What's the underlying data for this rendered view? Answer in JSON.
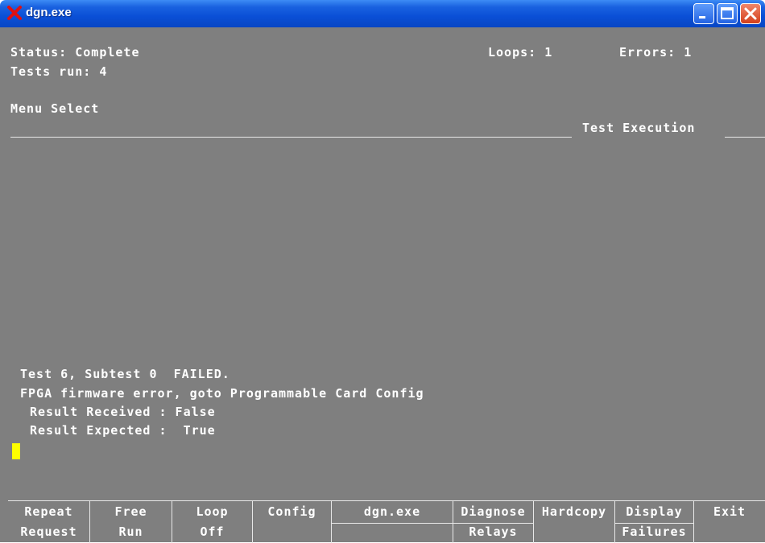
{
  "window": {
    "title": "dgn.exe",
    "icon": "red-x-icon",
    "controls": [
      "minimize-icon",
      "maximize-icon",
      "close-icon"
    ]
  },
  "header": {
    "status": "Status: Complete",
    "loops": "Loops: 1",
    "errors": "Errors: 1",
    "tests_run": "Tests run: 4",
    "menu_title": "Menu Select",
    "section_title": "Test Execution"
  },
  "output": {
    "line1": "Test 6, Subtest 0  FAILED.",
    "line2": "FPGA firmware error, goto Programmable Card Config",
    "line3": "Result Received : False",
    "line4": "Result Expected :  True"
  },
  "function_keys": [
    {
      "line1": "Repeat",
      "line2": "Request"
    },
    {
      "line1": "Free",
      "line2": "Run"
    },
    {
      "line1": "Loop",
      "line2": "Off"
    },
    {
      "line1": "Config",
      "line2": ""
    },
    {
      "line1": "dgn.exe",
      "line2": ""
    },
    {
      "line1": "Diagnose",
      "line2": "Relays"
    },
    {
      "line1": "Hardcopy",
      "line2": ""
    },
    {
      "line1": "Display",
      "line2": "Failures"
    },
    {
      "line1": "Exit",
      "line2": ""
    }
  ],
  "colors": {
    "title_bar": "#0a4fd6",
    "screen_background": "#7f7f7f",
    "text": "#ffffff",
    "cursor": "#ffff00"
  }
}
